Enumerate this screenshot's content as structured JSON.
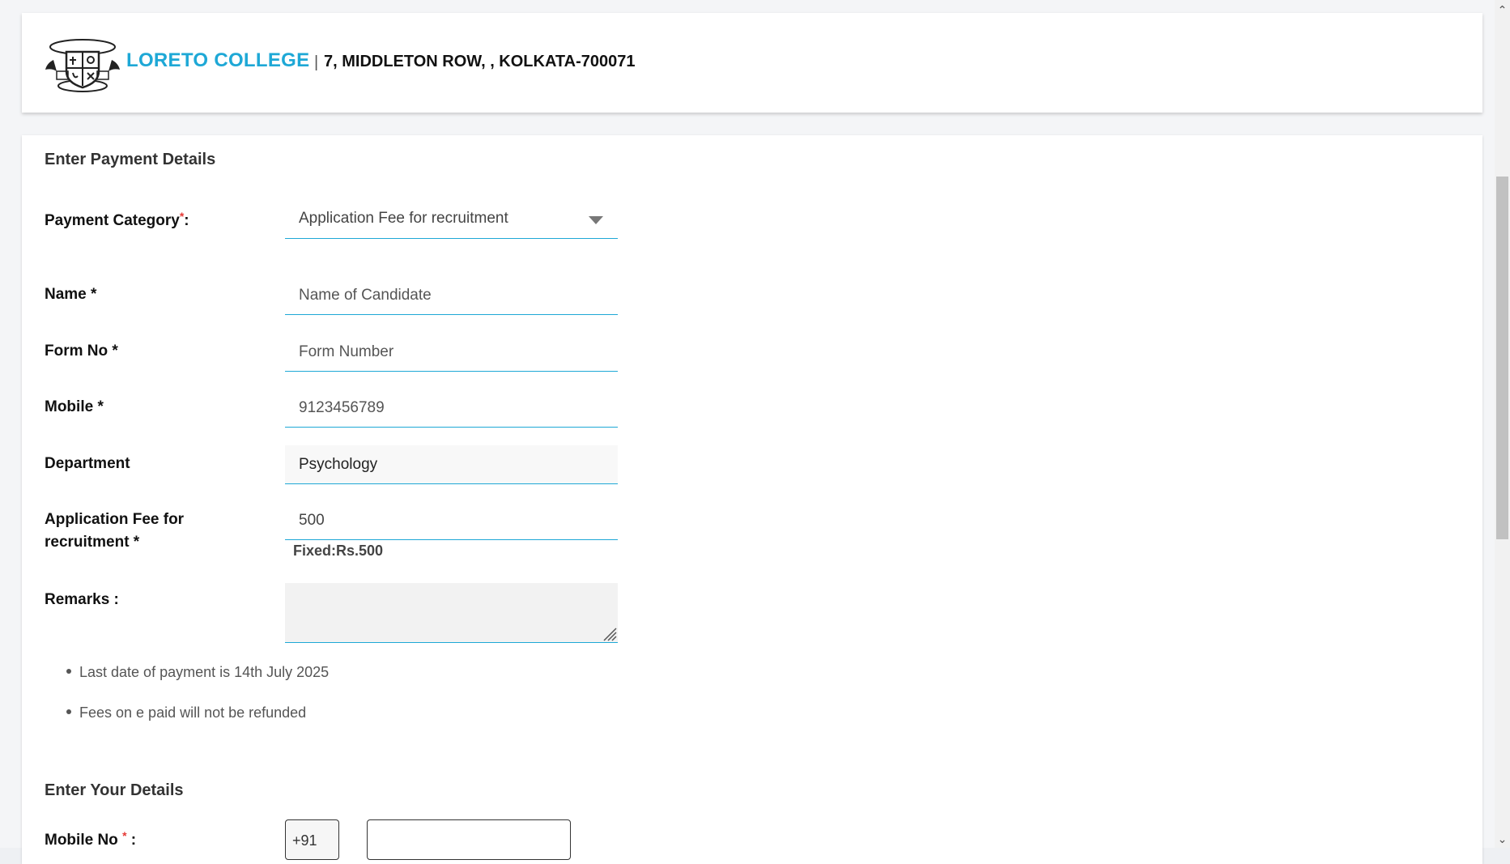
{
  "header": {
    "college_name": "LORETO COLLEGE",
    "separator": "|",
    "address": "7, MIDDLETON ROW, , KOLKATA-700071"
  },
  "payment_section": {
    "title": "Enter Payment Details",
    "payment_category": {
      "label": "Payment Category",
      "star": "*",
      "colon": ":",
      "value": "Application Fee for recruitment"
    },
    "name": {
      "label": "Name *",
      "placeholder": "Name of Candidate"
    },
    "form_no": {
      "label": "Form No *",
      "placeholder": "Form Number"
    },
    "mobile": {
      "label": "Mobile *",
      "placeholder": "9123456789"
    },
    "department": {
      "label": "Department",
      "value": "Psychology"
    },
    "fee": {
      "label_line1": "Application Fee for",
      "label_line2": "recruitment *",
      "value": "500",
      "fixed_note": "Fixed:Rs.500"
    },
    "remarks": {
      "label": "Remarks :",
      "value": ""
    },
    "notes": [
      "Last date of payment is 14th July 2025",
      "Fees on e paid will not be refunded"
    ]
  },
  "details_section": {
    "title": "Enter Your Details",
    "mobile_no": {
      "label": "Mobile No",
      "star": "*",
      "colon": " :",
      "country_code": "+91",
      "value": ""
    }
  },
  "icons": {
    "logo": "college-crest-logo",
    "select_caret": "caret-down-icon",
    "resize": "resize-grip-icon",
    "scroll_up": "chevron-up-icon",
    "scroll_down": "chevron-down-icon"
  },
  "colors": {
    "accent": "#1ea8d6",
    "required": "#e53935"
  }
}
